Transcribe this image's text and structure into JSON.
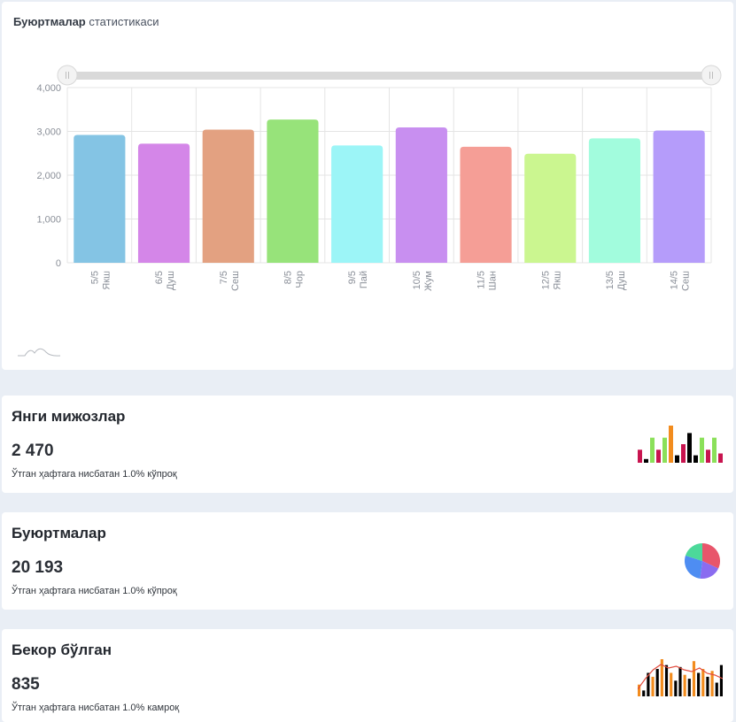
{
  "chart_card": {
    "title_bold": "Буюртмалар",
    "title_rest": "статистикаси"
  },
  "chart_data": {
    "type": "bar",
    "categories": [
      [
        "5/5",
        "Якш"
      ],
      [
        "6/5",
        "Душ"
      ],
      [
        "7/5",
        "Сеш"
      ],
      [
        "8/5",
        "Чор"
      ],
      [
        "9/5",
        "Пай"
      ],
      [
        "10/5",
        "Жум"
      ],
      [
        "11/5",
        "Шан"
      ],
      [
        "12/5",
        "Якш"
      ],
      [
        "13/5",
        "Душ"
      ],
      [
        "14/5",
        "Сеш"
      ]
    ],
    "values": [
      2920,
      2720,
      3040,
      3270,
      2680,
      3090,
      2650,
      2490,
      2840,
      3020
    ],
    "colors": [
      "#84c4e4",
      "#d486e8",
      "#e3a181",
      "#97e37a",
      "#9cf5f7",
      "#c88ff0",
      "#f59e96",
      "#cbf690",
      "#a2fcdd",
      "#b59cfa"
    ],
    "y_ticks": [
      "0",
      "1,000",
      "2,000",
      "3,000",
      "4,000"
    ],
    "ylim": [
      0,
      4000
    ],
    "grid": true,
    "range_slider": true
  },
  "stats": [
    {
      "title": "Янги мижозлар",
      "value": "2 470",
      "value_color": "#3fb24a",
      "note": "Ўтган ҳафтага нисбатан 1.0% кўпроқ",
      "spark": "bars",
      "spark_values": [
        14,
        4,
        27,
        14,
        27,
        40,
        8,
        20,
        32,
        8,
        27,
        14,
        27,
        10
      ],
      "spark_colors": [
        "#c8144f",
        "#000000",
        "#8be05a",
        "#c8144f",
        "#8be05a",
        "#f28c1e",
        "#000000",
        "#c8144f",
        "#000000",
        "#000000",
        "#8be05a",
        "#c8144f",
        "#8be05a",
        "#c8144f"
      ]
    },
    {
      "title": "Буюртмалар",
      "value": "20 193",
      "value_color": "#f1921d",
      "note": "Ўтган ҳафтага нисбатан 1.0% кўпроқ",
      "spark": "pie",
      "spark_values": [
        32,
        20,
        28,
        20
      ],
      "spark_colors": [
        "#e8566b",
        "#8a6cf0",
        "#4e8df2",
        "#4cd99a"
      ]
    },
    {
      "title": "Бекор бўлган",
      "value": "835",
      "value_color": "#24b8d8",
      "note": "Ўтган ҳафтага нисбатан 1.0% камроқ",
      "spark": "mixed",
      "spark_values": [
        12,
        6,
        24,
        20,
        28,
        38,
        32,
        24,
        16,
        30,
        22,
        18,
        36,
        24,
        28,
        20,
        26,
        14,
        32
      ],
      "spark_colors": [
        "#f28c1e",
        "#000000",
        "#000000",
        "#f28c1e",
        "#000000",
        "#f28c1e",
        "#000000",
        "#f28c1e",
        "#000000",
        "#000000",
        "#f28c1e",
        "#000000",
        "#f28c1e",
        "#000000",
        "#f28c1e",
        "#000000",
        "#f28c1e",
        "#000000",
        "#000000"
      ],
      "spark_line": [
        8,
        20,
        30,
        36,
        32,
        34,
        30,
        28,
        32,
        26,
        24,
        20
      ],
      "spark_line_color": "#e24b3d"
    }
  ]
}
